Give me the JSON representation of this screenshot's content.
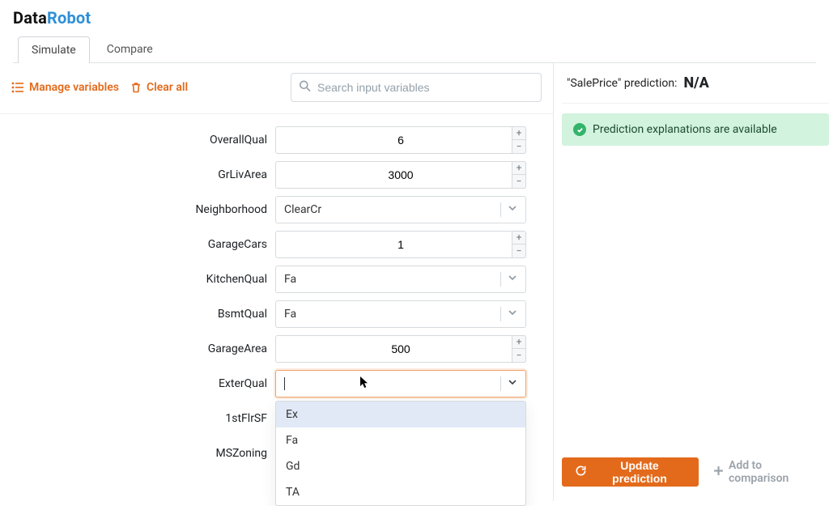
{
  "logo": {
    "part1": "Data",
    "part2": "Robot"
  },
  "tabs": {
    "simulate": "Simulate",
    "compare": "Compare",
    "active": "simulate"
  },
  "toolbar": {
    "manage_label": "Manage variables",
    "clear_label": "Clear all",
    "search_placeholder": "Search input variables"
  },
  "prediction": {
    "label": "\"SalePrice\" prediction:",
    "value": "N/A",
    "explanations_msg": "Prediction explanations are available"
  },
  "buttons": {
    "update": "Update prediction",
    "add_compare": "Add to comparison"
  },
  "fields": {
    "OverallQual": {
      "label": "OverallQual",
      "type": "number",
      "value": "6"
    },
    "GrLivArea": {
      "label": "GrLivArea",
      "type": "number",
      "value": "3000"
    },
    "Neighborhood": {
      "label": "Neighborhood",
      "type": "select",
      "value": "ClearCr"
    },
    "GarageCars": {
      "label": "GarageCars",
      "type": "number",
      "value": "1"
    },
    "KitchenQual": {
      "label": "KitchenQual",
      "type": "select",
      "value": "Fa"
    },
    "BsmtQual": {
      "label": "BsmtQual",
      "type": "select",
      "value": "Fa"
    },
    "GarageArea": {
      "label": "GarageArea",
      "type": "number",
      "value": "500"
    },
    "ExterQual": {
      "label": "ExterQual",
      "type": "select",
      "value": "",
      "open": true,
      "options": [
        "Ex",
        "Fa",
        "Gd",
        "TA"
      ],
      "highlight": 0
    },
    "FirstFlrSF": {
      "label": "1stFlrSF",
      "type": "number",
      "value": ""
    },
    "MSZoning": {
      "label": "MSZoning",
      "type": "select",
      "value": ""
    }
  }
}
